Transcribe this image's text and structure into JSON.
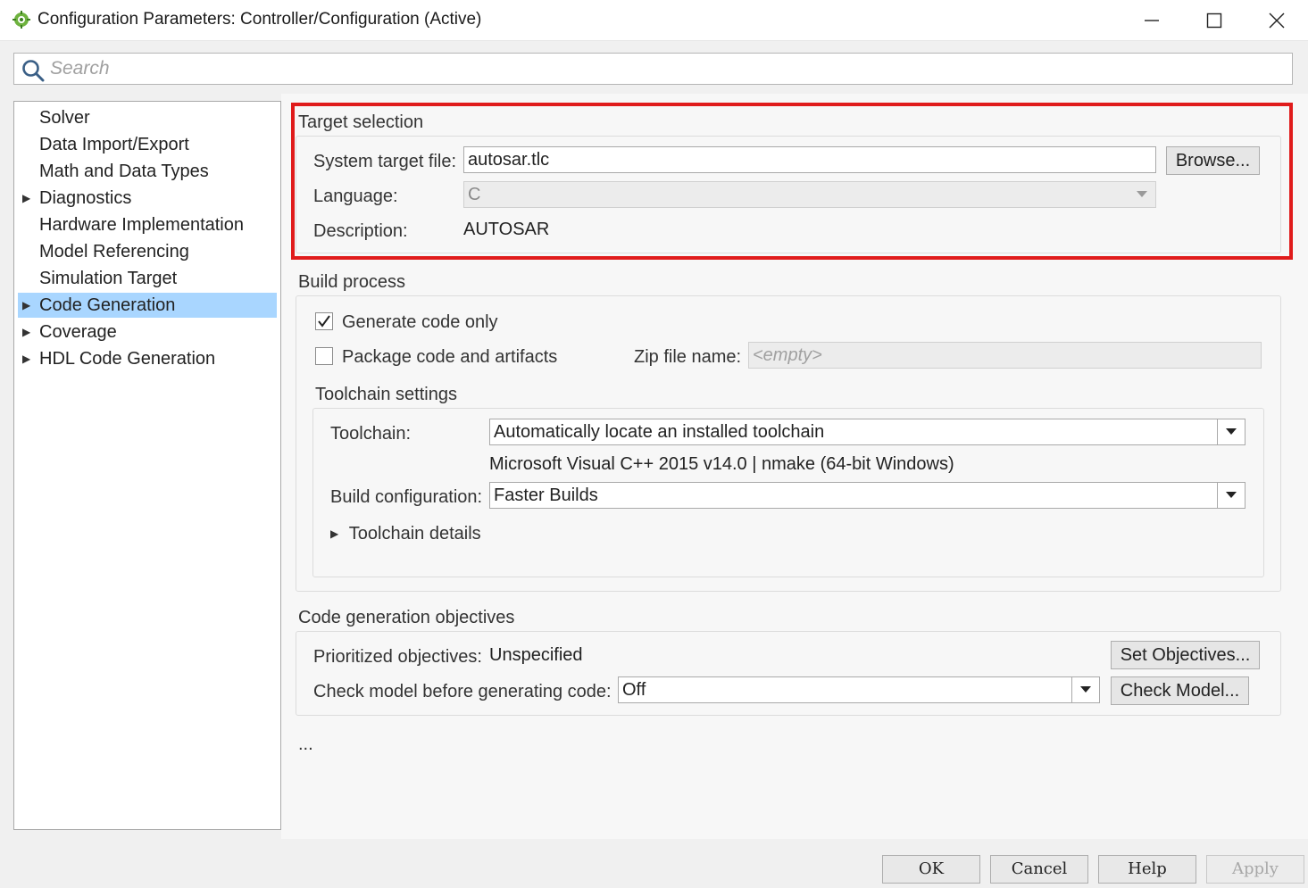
{
  "window": {
    "title": "Configuration Parameters: Controller/Configuration (Active)",
    "icon": "simulink-config-icon",
    "controls": [
      "minimize-icon",
      "maximize-icon",
      "close-icon"
    ]
  },
  "search": {
    "placeholder": "Search",
    "value": ""
  },
  "tree": {
    "items": [
      {
        "label": "Solver",
        "expandable": false,
        "selected": false
      },
      {
        "label": "Data Import/Export",
        "expandable": false,
        "selected": false
      },
      {
        "label": "Math and Data Types",
        "expandable": false,
        "selected": false
      },
      {
        "label": "Diagnostics",
        "expandable": true,
        "selected": false
      },
      {
        "label": "Hardware Implementation",
        "expandable": false,
        "selected": false
      },
      {
        "label": "Model Referencing",
        "expandable": false,
        "selected": false
      },
      {
        "label": "Simulation Target",
        "expandable": false,
        "selected": false
      },
      {
        "label": "Code Generation",
        "expandable": true,
        "selected": true
      },
      {
        "label": "Coverage",
        "expandable": true,
        "selected": false
      },
      {
        "label": "HDL Code Generation",
        "expandable": true,
        "selected": false
      }
    ],
    "selected_color": "#a9d6ff"
  },
  "target_selection": {
    "title": "Target selection",
    "system_target_label": "System target file:",
    "system_target_value": "autosar.tlc",
    "browse_label": "Browse...",
    "language_label": "Language:",
    "language_value": "C",
    "description_label": "Description:",
    "description_value": "AUTOSAR",
    "highlight_color": "#e01b1b"
  },
  "build_process": {
    "title": "Build process",
    "generate_code_only_label": "Generate code only",
    "generate_code_only_checked": true,
    "package_code_label": "Package code and artifacts",
    "package_code_checked": false,
    "zip_label": "Zip file name:",
    "zip_placeholder": "<empty>",
    "toolchain_settings_title": "Toolchain settings",
    "toolchain_label": "Toolchain:",
    "toolchain_value": "Automatically locate an installed toolchain",
    "toolchain_info": "Microsoft Visual C++ 2015 v14.0 | nmake (64-bit Windows)",
    "build_config_label": "Build configuration:",
    "build_config_value": "Faster Builds",
    "toolchain_details_label": "Toolchain details"
  },
  "objectives": {
    "title": "Code generation objectives",
    "prioritized_label": "Prioritized objectives:",
    "prioritized_value": "Unspecified",
    "set_objectives_label": "Set Objectives...",
    "check_model_label": "Check model before generating code:",
    "check_model_value": "Off",
    "check_model_button": "Check Model..."
  },
  "ellipsis": "...",
  "footer": {
    "ok": "OK",
    "cancel": "Cancel",
    "help": "Help",
    "apply": "Apply",
    "apply_disabled": true
  }
}
